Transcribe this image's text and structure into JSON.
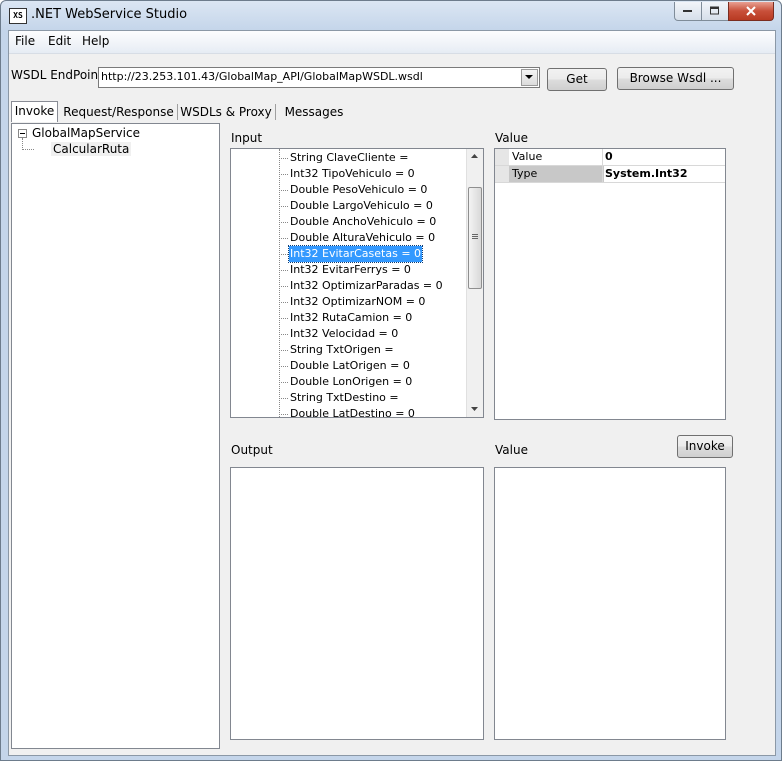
{
  "window": {
    "title": ".NET WebService Studio",
    "icon_text": "XS"
  },
  "menu": [
    "File",
    "Edit",
    "Help"
  ],
  "wsdl": {
    "label": "WSDL EndPoint",
    "url": "http://23.253.101.43/GlobalMap_API/GlobalMapWSDL.wsdl",
    "get_label": "Get",
    "browse_label": "Browse Wsdl ..."
  },
  "tabs": [
    "Invoke",
    "Request/Response",
    "WSDLs & Proxy",
    "Messages"
  ],
  "tree": {
    "root": "GlobalMapService",
    "child": "CalcularRuta"
  },
  "input": {
    "label": "Input",
    "rows": [
      "String ClaveCliente =",
      "Int32 TipoVehiculo = 0",
      "Double PesoVehiculo = 0",
      "Double LargoVehiculo = 0",
      "Double AnchoVehiculo = 0",
      "Double AlturaVehiculo = 0",
      "Int32 EvitarCasetas = 0",
      "Int32 EvitarFerrys = 0",
      "Int32 OptimizarParadas = 0",
      "Int32 OptimizarNOM = 0",
      "Int32 RutaCamion = 0",
      "Int32 Velocidad = 0",
      "String TxtOrigen =",
      "Double LatOrigen = 0",
      "Double LonOrigen = 0",
      "String TxtDestino =",
      "Double LatDestino = 0"
    ],
    "selected_index": 6
  },
  "value_top": {
    "label": "Value",
    "rows": [
      {
        "key": "Value",
        "val": "0"
      },
      {
        "key": "Type",
        "val": "System.Int32"
      }
    ]
  },
  "output": {
    "label": "Output"
  },
  "value_bottom": {
    "label": "Value"
  },
  "invoke_label": "Invoke"
}
